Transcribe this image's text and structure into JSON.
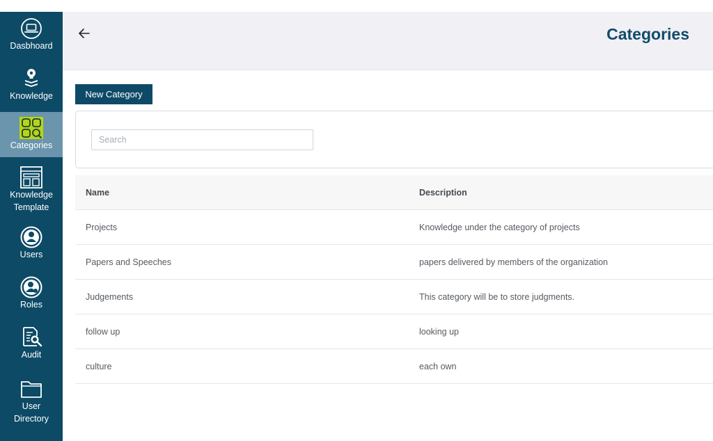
{
  "sidebar": {
    "items": [
      {
        "label": "Dasbhoard",
        "icon": "laptop-icon"
      },
      {
        "label": "Knowledge",
        "icon": "lightbulb-icon"
      },
      {
        "label": "Categories",
        "icon": "categories-icon"
      },
      {
        "label": "Knowledge Template",
        "icon": "template-icon"
      },
      {
        "label": "Users",
        "icon": "user-icon"
      },
      {
        "label": "Roles",
        "icon": "role-icon"
      },
      {
        "label": "Audit",
        "icon": "audit-icon"
      },
      {
        "label": "User Directory",
        "icon": "folder-icon"
      }
    ],
    "active": "Categories"
  },
  "header": {
    "title": "Categories",
    "back_icon": "arrow-left-icon"
  },
  "toolbar": {
    "new_label": "New Category"
  },
  "search": {
    "placeholder": "Search",
    "value": ""
  },
  "table": {
    "columns": [
      "Name",
      "Description"
    ],
    "rows": [
      {
        "name": "Projects",
        "description": "Knowledge under the category of projects"
      },
      {
        "name": "Papers and Speeches",
        "description": "papers delivered by members of the organization"
      },
      {
        "name": "Judgements",
        "description": "This category will be to store judgments."
      },
      {
        "name": "follow up",
        "description": "looking up"
      },
      {
        "name": "culture",
        "description": "each own"
      }
    ]
  },
  "colors": {
    "sidebar": "#0d4a66",
    "sidebar_active": "#6b95ad",
    "accent": "#0e4a67",
    "title": "#114b68",
    "icon_highlight": "#b5d51a"
  }
}
